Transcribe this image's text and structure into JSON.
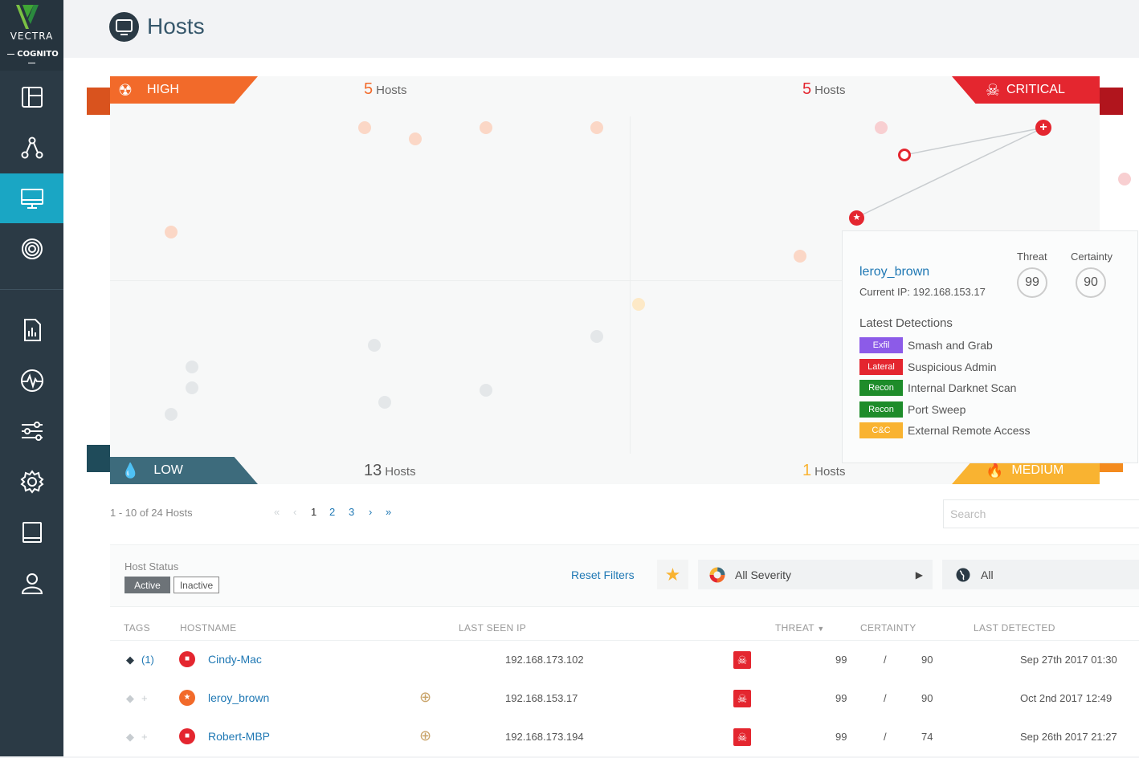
{
  "app": {
    "brand": "VECTRA",
    "product": "COGNITO"
  },
  "page": {
    "title": "Hosts"
  },
  "colors": {
    "sidebar": "#2b3a45",
    "active_nav": "#1aa6c4",
    "high": "#f26a2a",
    "critical": "#e4262f",
    "low": "#3d6b7c",
    "medium": "#f9b331",
    "link": "#1f78b4"
  },
  "sidebar": {
    "items": [
      {
        "icon": "layout-icon"
      },
      {
        "icon": "network-icon"
      },
      {
        "icon": "monitor-icon",
        "active": true
      },
      {
        "icon": "target-icon"
      },
      {
        "icon": "report-icon"
      },
      {
        "icon": "pulse-icon"
      },
      {
        "icon": "sliders-icon"
      },
      {
        "icon": "gear-icon"
      },
      {
        "icon": "book-icon"
      },
      {
        "icon": "user-icon"
      }
    ]
  },
  "quadrant": {
    "high": {
      "label": "HIGH",
      "count": "5",
      "unit": "Hosts"
    },
    "critical": {
      "label": "CRITICAL",
      "count": "5",
      "unit": "Hosts"
    },
    "low": {
      "label": "LOW",
      "count": "13",
      "unit": "Hosts"
    },
    "medium": {
      "label": "MEDIUM",
      "count": "1",
      "unit": "Hosts"
    }
  },
  "popup": {
    "host": "leroy_brown",
    "ip_label": "Current IP:",
    "ip": "192.168.153.17",
    "threat_label": "Threat",
    "threat": "99",
    "certainty_label": "Certainty",
    "certainty": "90",
    "detections_title": "Latest Detections",
    "detections": [
      {
        "category": "Exfil",
        "name": "Smash and Grab",
        "color": "#8c5be8"
      },
      {
        "category": "Lateral",
        "name": "Suspicious Admin",
        "color": "#e4262f"
      },
      {
        "category": "Recon",
        "name": "Internal Darknet Scan",
        "color": "#1e8c2a"
      },
      {
        "category": "Recon",
        "name": "Port Sweep",
        "color": "#1e8c2a"
      },
      {
        "category": "C&C",
        "name": "External Remote Access",
        "color": "#f9b331"
      }
    ]
  },
  "pagination": {
    "range": "1 - 10 of 24 Hosts",
    "pages": [
      "1",
      "2",
      "3"
    ]
  },
  "search": {
    "placeholder": "Search"
  },
  "filters": {
    "host_status_label": "Host Status",
    "active": "Active",
    "inactive": "Inactive",
    "reset": "Reset Filters",
    "severity": "All Severity",
    "scope": "All"
  },
  "table": {
    "headers": {
      "tags": "TAGS",
      "hostname": "HOSTNAME",
      "last_seen_ip": "LAST SEEN IP",
      "threat": "THREAT",
      "certainty": "CERTAINTY",
      "last_detected": "LAST DETECTED"
    },
    "rows": [
      {
        "tags": "(1)",
        "hostname": "Cindy-Mac",
        "ip": "192.168.173.102",
        "threat": "99",
        "sep": "/",
        "certainty": "90",
        "last_detected": "Sep 27th 2017 01:30"
      },
      {
        "tags": "+",
        "hostname": "leroy_brown",
        "ip": "192.168.153.17",
        "threat": "99",
        "sep": "/",
        "certainty": "90",
        "last_detected": "Oct 2nd 2017 12:49"
      },
      {
        "tags": "+",
        "hostname": "Robert-MBP",
        "ip": "192.168.173.194",
        "threat": "99",
        "sep": "/",
        "certainty": "74",
        "last_detected": "Sep 26th 2017 21:27"
      }
    ]
  }
}
